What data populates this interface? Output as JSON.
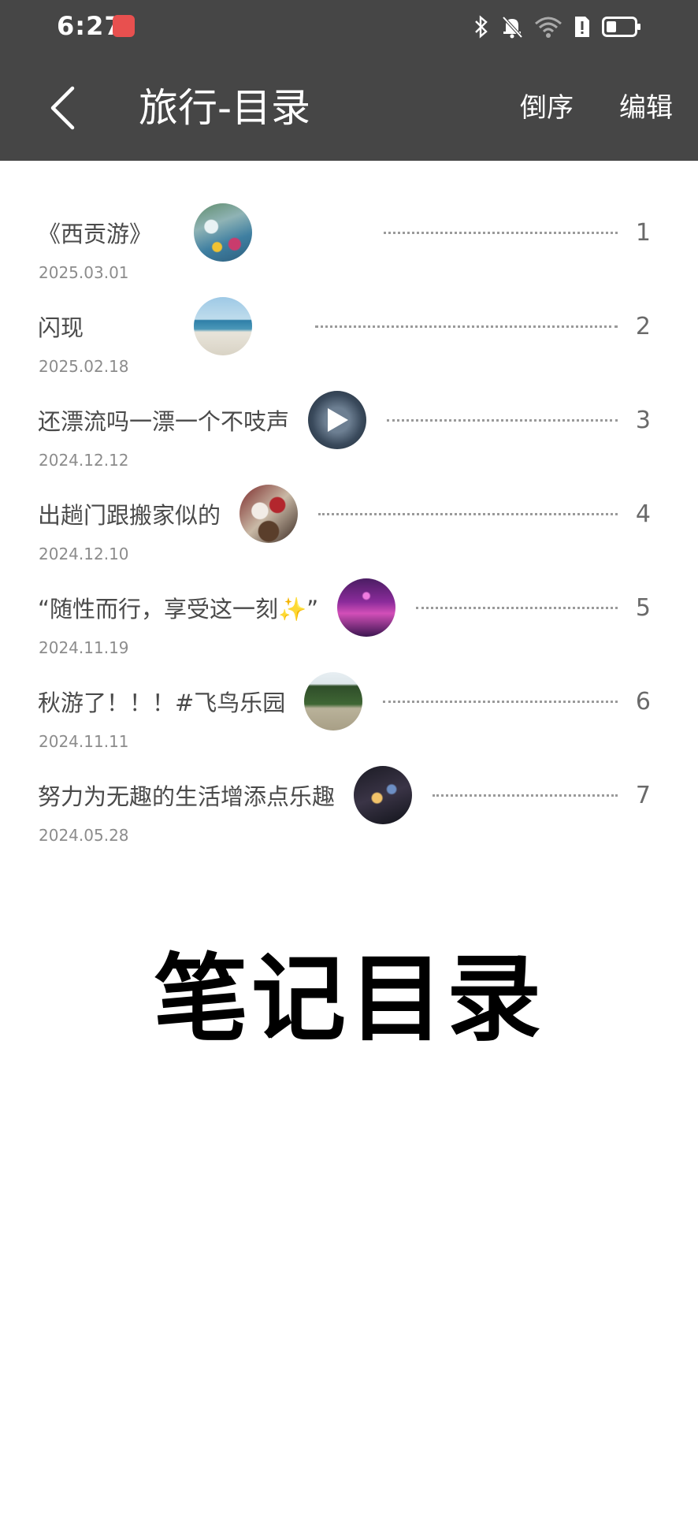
{
  "status_bar": {
    "time": "6:27",
    "icons": [
      "bluetooth-icon",
      "bell-muted-icon",
      "wifi-icon",
      "sim-alert-icon",
      "battery-icon"
    ]
  },
  "header": {
    "title": "旅行-目录",
    "actions": {
      "reverse": "倒序",
      "edit": "编辑"
    }
  },
  "toc": [
    {
      "title": "《西贡游》",
      "date": "2025.03.01",
      "number": "1",
      "thumb": "water-park"
    },
    {
      "title": "闪现",
      "date": "2025.02.18",
      "number": "2",
      "thumb": "beach"
    },
    {
      "title": "还漂流吗一漂一个不吱声",
      "date": "2024.12.12",
      "number": "3",
      "thumb": "video-play"
    },
    {
      "title": "出趟门跟搬家似的",
      "date": "2024.12.10",
      "number": "4",
      "thumb": "luggage"
    },
    {
      "title": "“随性而行，享受这一刻✨”",
      "date": "2024.11.19",
      "number": "5",
      "thumb": "night-tower"
    },
    {
      "title": "秋游了！！！#飞鸟乐园",
      "date": "2024.11.11",
      "number": "6",
      "thumb": "bird-park"
    },
    {
      "title": "努力为无趣的生活增添点乐趣",
      "date": "2024.05.28",
      "number": "7",
      "thumb": "night-street"
    }
  ],
  "footer": {
    "heading": "笔记目录"
  },
  "colors": {
    "header_bg": "#464646",
    "text": "#4a4a4a",
    "date": "#8c8c8c",
    "app_badge": "#e8504f"
  }
}
